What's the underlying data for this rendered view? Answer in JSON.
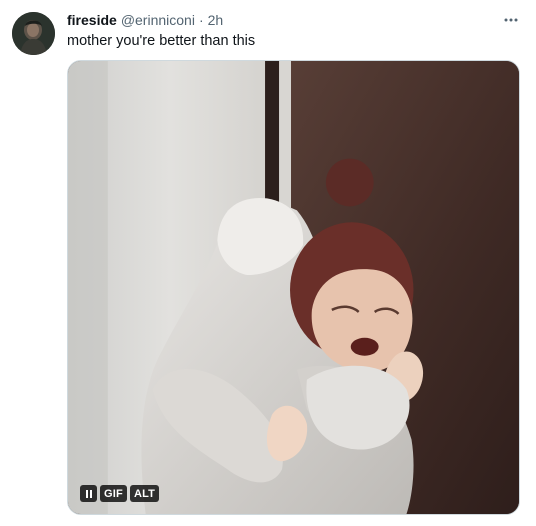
{
  "tweet": {
    "display_name": "fireside",
    "handle": "@erinniconi",
    "separator": "·",
    "time": "2h",
    "text": "mother you're better than this"
  },
  "media": {
    "type": "gif",
    "description_alt": "",
    "controls": {
      "pause_icon": "pause-icon",
      "gif_label": "GIF",
      "alt_label": "ALT"
    }
  },
  "icons": {
    "more": "more-horizontal-icon"
  },
  "colors": {
    "text_primary": "#0f1419",
    "text_secondary": "#536471",
    "border": "#cfd9de",
    "badge_bg": "#000000"
  }
}
